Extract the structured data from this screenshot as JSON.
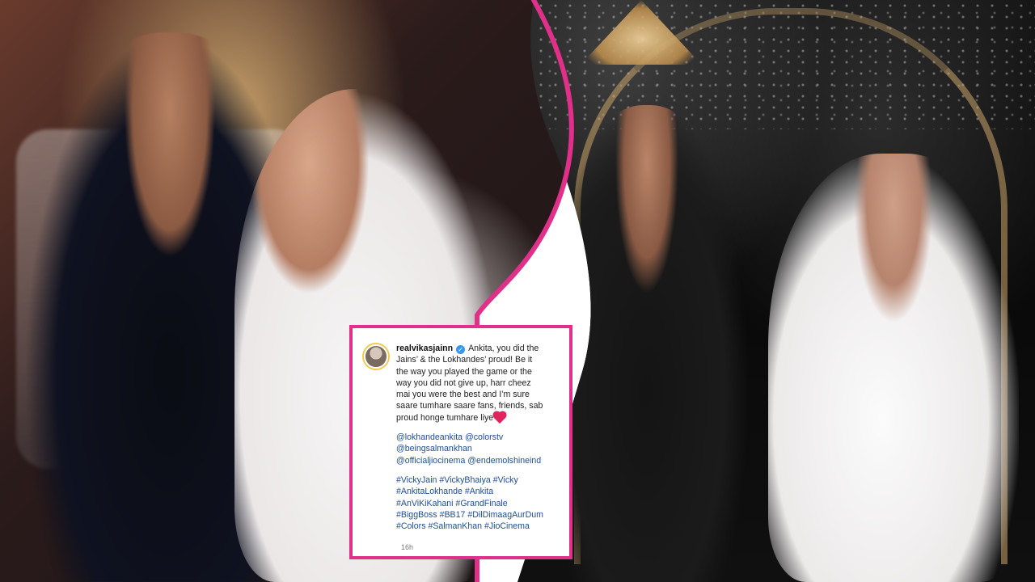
{
  "post": {
    "username": "realvikasjainn",
    "caption_lines": [
      "Ankita, you did the",
      "Jains’ & the Lokhandes’ proud! Be it",
      "the way you played the game or the",
      "way you did not give up, harr cheez",
      "mai you were the best and I’m sure",
      "saare tumhare saare fans, friends, sab",
      "proud honge tumhare liye"
    ],
    "mention_lines": [
      "@lokhandeankita @colorstv",
      "@beingsalmankhan",
      "@officialjiocinema @endemolshineind"
    ],
    "hashtag_lines": [
      "#VickyJain #VickyBhaiya #Vicky",
      "#AnkitaLokhande #Ankita",
      "#AnViKiKahani #GrandFinale",
      "#BiggBoss #BB17 #DilDimaagAurDum",
      "#Colors #SalmanKhan #JioCinema"
    ],
    "time": "16h"
  },
  "colors": {
    "accent_pink": "#e0308a",
    "instagram_blue": "#3897f0",
    "mention_blue": "#1e4d9c",
    "card_bg": "#ffffff"
  },
  "icons": {
    "verified_badge": "verified-icon",
    "heart": "heart-icon",
    "avatar": "avatar"
  }
}
